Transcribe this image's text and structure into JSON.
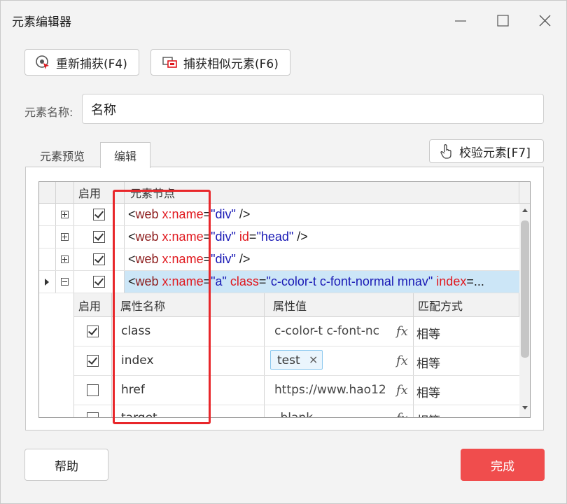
{
  "window": {
    "title": "元素编辑器"
  },
  "toolbar": {
    "recapture_label": "重新捕获(F4)",
    "capture_similar_label": "捕获相似元素(F6)"
  },
  "name_field": {
    "label": "元素名称:",
    "value": "名称"
  },
  "tabs": [
    {
      "label": "元素预览"
    },
    {
      "label": "编辑"
    }
  ],
  "validate_label": "校验元素[F7]",
  "grid": {
    "headers": {
      "enable": "启用",
      "node": "元素节点"
    },
    "rows": [
      {
        "parts": [
          [
            "p",
            "<"
          ],
          [
            "t",
            "web "
          ],
          [
            "a",
            "x:name"
          ],
          [
            "p",
            "="
          ],
          [
            "v",
            "\"div\""
          ],
          [
            "p",
            " />"
          ]
        ]
      },
      {
        "parts": [
          [
            "p",
            "<"
          ],
          [
            "t",
            "web "
          ],
          [
            "a",
            "x:name"
          ],
          [
            "p",
            "="
          ],
          [
            "v",
            "\"div\""
          ],
          [
            "p",
            " "
          ],
          [
            "a",
            "id"
          ],
          [
            "p",
            "="
          ],
          [
            "v",
            "\"head\""
          ],
          [
            "p",
            " />"
          ]
        ]
      },
      {
        "parts": [
          [
            "p",
            "<"
          ],
          [
            "t",
            "web "
          ],
          [
            "a",
            "x:name"
          ],
          [
            "p",
            "="
          ],
          [
            "v",
            "\"div\""
          ],
          [
            "p",
            " />"
          ]
        ]
      },
      {
        "parts": [
          [
            "p",
            "<"
          ],
          [
            "t",
            "web "
          ],
          [
            "a",
            "x:name"
          ],
          [
            "p",
            "="
          ],
          [
            "v",
            "\"a\""
          ],
          [
            "p",
            " "
          ],
          [
            "a",
            "class"
          ],
          [
            "p",
            "="
          ],
          [
            "v",
            "\"c-color-t c-font-normal mnav\""
          ],
          [
            "p",
            " "
          ],
          [
            "a",
            "index"
          ],
          [
            "p",
            "=..."
          ]
        ]
      }
    ],
    "sub_headers": {
      "enable": "启用",
      "attr_name": "属性名称",
      "attr_value": "属性值",
      "match": "匹配方式"
    },
    "attributes": [
      {
        "checked": true,
        "name": "class",
        "value": "c-color-t c-font-nc",
        "match": "相等"
      },
      {
        "checked": true,
        "name": "index",
        "tag": "test",
        "match": "相等"
      },
      {
        "checked": false,
        "name": "href",
        "value": "https://www.hao12",
        "match": "相等"
      },
      {
        "checked": false,
        "name": "target",
        "value": "_blank",
        "match": "相等"
      }
    ],
    "fx_symbol": "fx",
    "tag_close": "×"
  },
  "footer": {
    "help_label": "帮助",
    "done_label": "完成"
  },
  "colors": {
    "done_bg": "#f04d4d",
    "highlight_box": "#e8262a",
    "selected_row": "#cce6f7"
  }
}
